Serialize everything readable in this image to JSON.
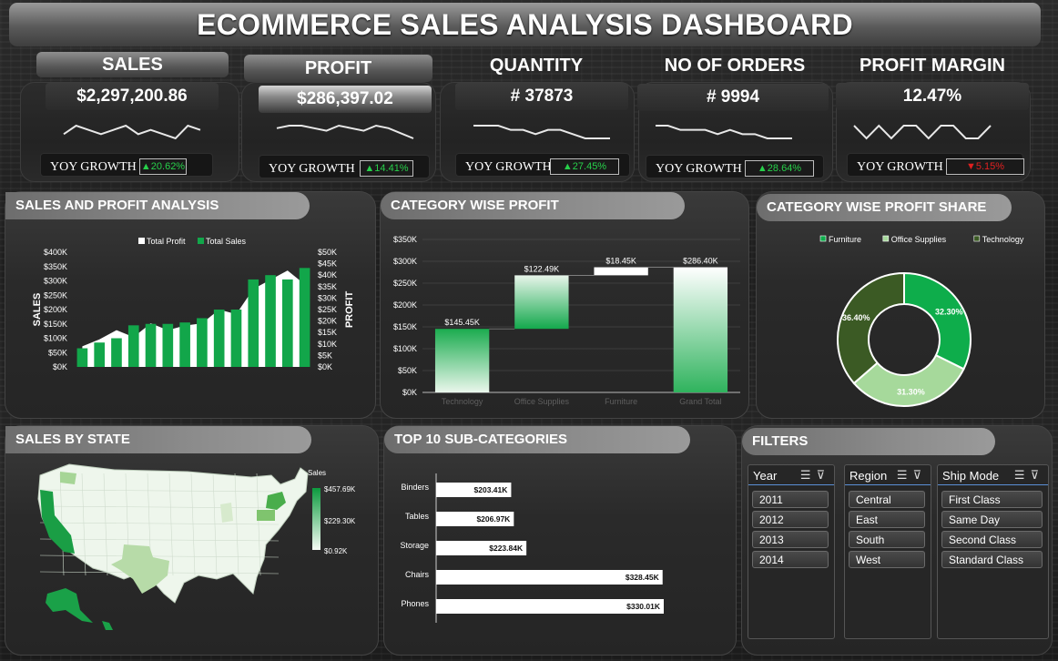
{
  "title": "ECOMMERCE SALES ANALYSIS DASHBOARD",
  "kpis": [
    {
      "label": "SALES",
      "value": "$2,297,200.86",
      "yoy_label": "YOY GROWTH",
      "yoy": "20.62%",
      "dir": "up",
      "spark": [
        5,
        7,
        6,
        5,
        6,
        7,
        5,
        6,
        5,
        4,
        7,
        6
      ]
    },
    {
      "label": "PROFIT",
      "value": "$286,397.02",
      "yoy_label": "YOY GROWTH",
      "yoy": "14.41%",
      "dir": "up",
      "spark": [
        5,
        6,
        6,
        5,
        4,
        6,
        5,
        4,
        6,
        5,
        3,
        1
      ]
    },
    {
      "label": "QUANTITY",
      "value": "# 37873",
      "yoy_label": "YOY GROWTH",
      "yoy": "27.45%",
      "dir": "up",
      "spark": [
        6,
        6,
        6,
        5,
        5,
        4,
        5,
        5,
        4,
        3,
        3,
        3
      ]
    },
    {
      "label": "NO OF ORDERS",
      "value": "# 9994",
      "yoy_label": "YOY GROWTH",
      "yoy": "28.64%",
      "dir": "up",
      "spark": [
        6,
        6,
        5,
        5,
        5,
        4,
        5,
        4,
        4,
        3,
        3,
        3
      ]
    },
    {
      "label": "PROFIT MARGIN",
      "value": "12.47%",
      "yoy_label": "YOY GROWTH",
      "yoy": "5.15%",
      "dir": "down",
      "spark": [
        5,
        4,
        5,
        4,
        5,
        5,
        4,
        5,
        5,
        4,
        4,
        5
      ]
    }
  ],
  "panels": {
    "sales_profit": "SALES AND PROFIT ANALYSIS",
    "category_profit": "CATEGORY WISE PROFIT",
    "category_share": "CATEGORY WISE PROFIT SHARE",
    "sales_by_state": "SALES BY STATE",
    "top10": "TOP 10 SUB-CATEGORIES",
    "filters": "FILTERS"
  },
  "chart_data": [
    {
      "type": "bar",
      "title": "SALES AND PROFIT ANALYSIS",
      "ylabel": "SALES",
      "y2label": "PROFIT",
      "legend_position": "top",
      "series": [
        {
          "name": "Total Profit",
          "type": "area",
          "axis": "right",
          "color": "#ffffff",
          "values": [
            9000,
            12000,
            16000,
            13000,
            19000,
            16000,
            18000,
            19000,
            25000,
            23000,
            34000,
            38000,
            42000,
            36000
          ]
        },
        {
          "name": "Total Sales",
          "type": "bar",
          "axis": "left",
          "color": "#12a64a",
          "values": [
            65000,
            85000,
            100000,
            145000,
            150000,
            150000,
            155000,
            170000,
            200000,
            200000,
            305000,
            320000,
            305000,
            345000
          ]
        }
      ],
      "yticks": [
        "$0K",
        "$50K",
        "$100K",
        "$150K",
        "$200K",
        "$250K",
        "$300K",
        "$350K",
        "$400K"
      ],
      "y2ticks": [
        "$0K",
        "$5K",
        "$10K",
        "$15K",
        "$20K",
        "$25K",
        "$30K",
        "$35K",
        "$40K",
        "$45K",
        "$50K"
      ],
      "ylim": [
        0,
        400000
      ],
      "y2lim": [
        0,
        50000
      ]
    },
    {
      "type": "waterfall",
      "title": "CATEGORY WISE PROFIT",
      "categories": [
        "Technology",
        "Office Supplies",
        "Furniture",
        "Grand Total"
      ],
      "values": [
        145.45,
        122.49,
        18.45,
        286.4
      ],
      "labels": [
        "$145.45K",
        "$122.49K",
        "$18.45K",
        "$286.40K"
      ],
      "yticks": [
        "$0K",
        "$50K",
        "$100K",
        "$150K",
        "$200K",
        "$250K",
        "$300K",
        "$350K"
      ],
      "ylim": [
        0,
        350
      ]
    },
    {
      "type": "pie",
      "title": "CATEGORY WISE PROFIT SHARE",
      "legend_position": "top",
      "labels": [
        "Furniture",
        "Office Supplies",
        "Technology"
      ],
      "values": [
        32.3,
        31.3,
        36.4
      ],
      "value_labels": [
        "32.30%",
        "31.30%",
        "36.40%"
      ],
      "colors": [
        "#0ead4b",
        "#a6d99b",
        "#3b5a24"
      ]
    },
    {
      "type": "map",
      "title": "SALES BY STATE",
      "legend_title": "Sales",
      "scale_labels": [
        "$457.69K",
        "$229.30K",
        "$0.92K"
      ]
    },
    {
      "type": "bar",
      "orientation": "horizontal",
      "title": "TOP 10 SUB-CATEGORIES",
      "categories": [
        "Binders",
        "Tables",
        "Storage",
        "Chairs",
        "Phones"
      ],
      "values": [
        203.41,
        206.97,
        223.84,
        328.45,
        330.01
      ],
      "labels": [
        "$203.41K",
        "$206.97K",
        "$223.84K",
        "$328.45K",
        "$330.01K"
      ]
    }
  ],
  "filters": [
    {
      "name": "Year",
      "items": [
        "2011",
        "2012",
        "2013",
        "2014"
      ]
    },
    {
      "name": "Region",
      "items": [
        "Central",
        "East",
        "South",
        "West"
      ]
    },
    {
      "name": "Ship Mode",
      "items": [
        "First Class",
        "Same Day",
        "Second Class",
        "Standard Class"
      ]
    }
  ]
}
